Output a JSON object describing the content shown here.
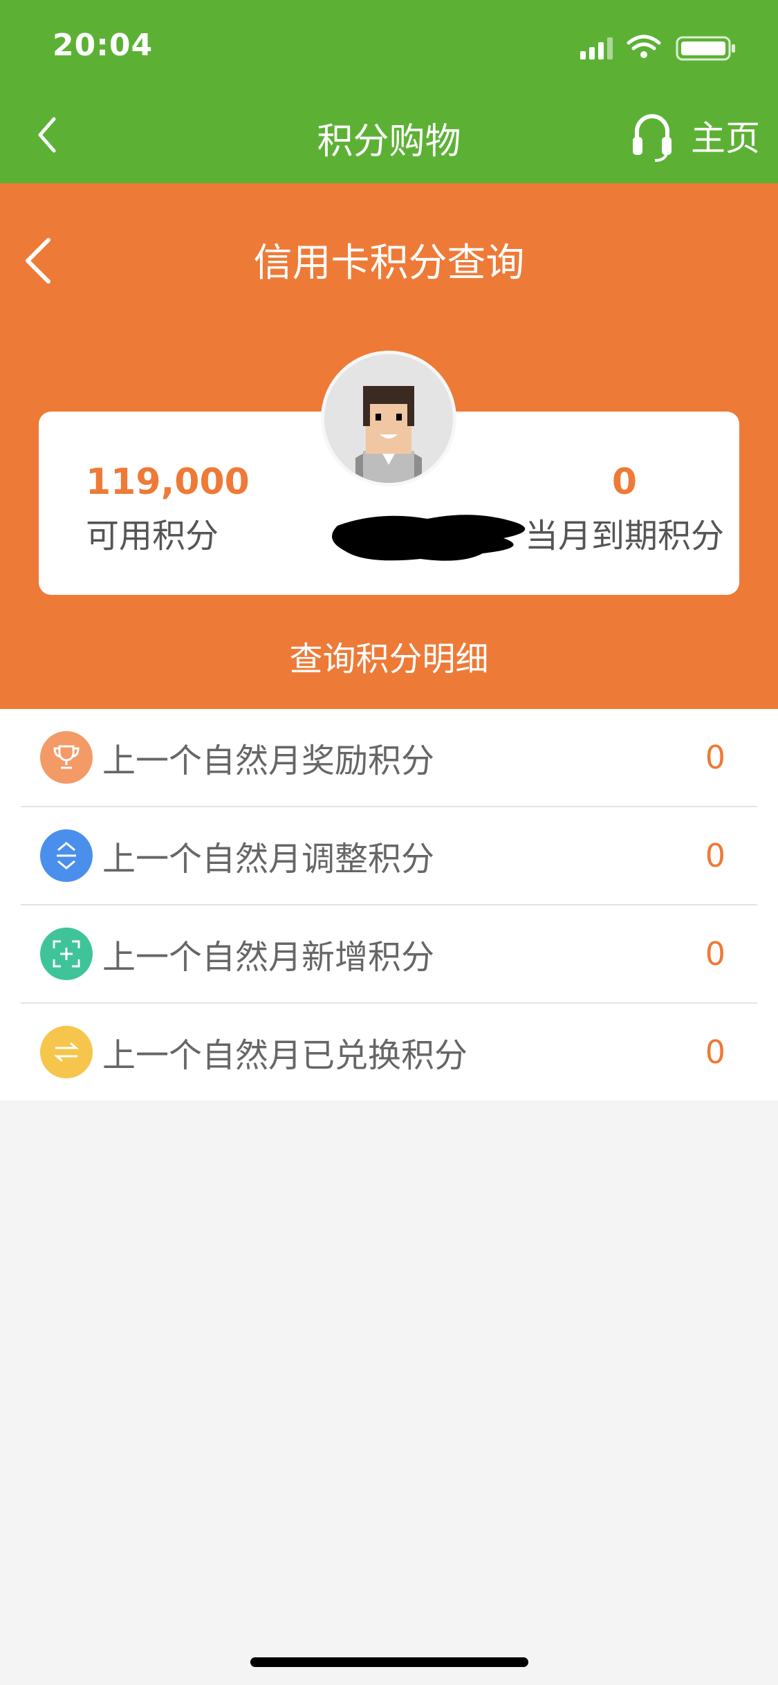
{
  "status": {
    "time": "20:04"
  },
  "nav": {
    "title": "积分购物",
    "home_label": "主页"
  },
  "header": {
    "title": "信用卡积分查询"
  },
  "points": {
    "available_value": "119,000",
    "available_label": "可用积分",
    "expiring_value": "0",
    "expiring_label": "当月到期积分"
  },
  "detail_link": "查询积分明细",
  "list": {
    "items": [
      {
        "label": "上一个自然月奖励积分",
        "value": "0",
        "icon": "trophy-icon",
        "color": "#f39a67"
      },
      {
        "label": "上一个自然月调整积分",
        "value": "0",
        "icon": "adjust-icon",
        "color": "#4a8fec"
      },
      {
        "label": "上一个自然月新增积分",
        "value": "0",
        "icon": "add-icon",
        "color": "#3fc49a"
      },
      {
        "label": "上一个自然月已兑换积分",
        "value": "0",
        "icon": "exchange-icon",
        "color": "#f6c54b"
      }
    ]
  },
  "colors": {
    "green": "#5cb135",
    "orange": "#ee7a37"
  }
}
